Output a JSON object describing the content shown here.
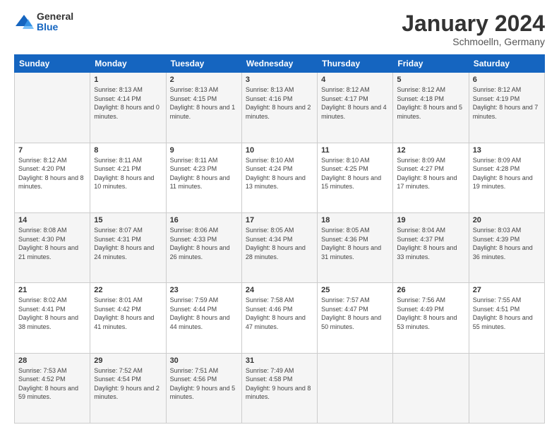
{
  "logo": {
    "general": "General",
    "blue": "Blue"
  },
  "header": {
    "month": "January 2024",
    "location": "Schmoelln, Germany"
  },
  "days_of_week": [
    "Sunday",
    "Monday",
    "Tuesday",
    "Wednesday",
    "Thursday",
    "Friday",
    "Saturday"
  ],
  "weeks": [
    [
      {
        "day": "",
        "sunrise": "",
        "sunset": "",
        "daylight": ""
      },
      {
        "day": "1",
        "sunrise": "Sunrise: 8:13 AM",
        "sunset": "Sunset: 4:14 PM",
        "daylight": "Daylight: 8 hours and 0 minutes."
      },
      {
        "day": "2",
        "sunrise": "Sunrise: 8:13 AM",
        "sunset": "Sunset: 4:15 PM",
        "daylight": "Daylight: 8 hours and 1 minute."
      },
      {
        "day": "3",
        "sunrise": "Sunrise: 8:13 AM",
        "sunset": "Sunset: 4:16 PM",
        "daylight": "Daylight: 8 hours and 2 minutes."
      },
      {
        "day": "4",
        "sunrise": "Sunrise: 8:12 AM",
        "sunset": "Sunset: 4:17 PM",
        "daylight": "Daylight: 8 hours and 4 minutes."
      },
      {
        "day": "5",
        "sunrise": "Sunrise: 8:12 AM",
        "sunset": "Sunset: 4:18 PM",
        "daylight": "Daylight: 8 hours and 5 minutes."
      },
      {
        "day": "6",
        "sunrise": "Sunrise: 8:12 AM",
        "sunset": "Sunset: 4:19 PM",
        "daylight": "Daylight: 8 hours and 7 minutes."
      }
    ],
    [
      {
        "day": "7",
        "sunrise": "Sunrise: 8:12 AM",
        "sunset": "Sunset: 4:20 PM",
        "daylight": "Daylight: 8 hours and 8 minutes."
      },
      {
        "day": "8",
        "sunrise": "Sunrise: 8:11 AM",
        "sunset": "Sunset: 4:21 PM",
        "daylight": "Daylight: 8 hours and 10 minutes."
      },
      {
        "day": "9",
        "sunrise": "Sunrise: 8:11 AM",
        "sunset": "Sunset: 4:23 PM",
        "daylight": "Daylight: 8 hours and 11 minutes."
      },
      {
        "day": "10",
        "sunrise": "Sunrise: 8:10 AM",
        "sunset": "Sunset: 4:24 PM",
        "daylight": "Daylight: 8 hours and 13 minutes."
      },
      {
        "day": "11",
        "sunrise": "Sunrise: 8:10 AM",
        "sunset": "Sunset: 4:25 PM",
        "daylight": "Daylight: 8 hours and 15 minutes."
      },
      {
        "day": "12",
        "sunrise": "Sunrise: 8:09 AM",
        "sunset": "Sunset: 4:27 PM",
        "daylight": "Daylight: 8 hours and 17 minutes."
      },
      {
        "day": "13",
        "sunrise": "Sunrise: 8:09 AM",
        "sunset": "Sunset: 4:28 PM",
        "daylight": "Daylight: 8 hours and 19 minutes."
      }
    ],
    [
      {
        "day": "14",
        "sunrise": "Sunrise: 8:08 AM",
        "sunset": "Sunset: 4:30 PM",
        "daylight": "Daylight: 8 hours and 21 minutes."
      },
      {
        "day": "15",
        "sunrise": "Sunrise: 8:07 AM",
        "sunset": "Sunset: 4:31 PM",
        "daylight": "Daylight: 8 hours and 24 minutes."
      },
      {
        "day": "16",
        "sunrise": "Sunrise: 8:06 AM",
        "sunset": "Sunset: 4:33 PM",
        "daylight": "Daylight: 8 hours and 26 minutes."
      },
      {
        "day": "17",
        "sunrise": "Sunrise: 8:05 AM",
        "sunset": "Sunset: 4:34 PM",
        "daylight": "Daylight: 8 hours and 28 minutes."
      },
      {
        "day": "18",
        "sunrise": "Sunrise: 8:05 AM",
        "sunset": "Sunset: 4:36 PM",
        "daylight": "Daylight: 8 hours and 31 minutes."
      },
      {
        "day": "19",
        "sunrise": "Sunrise: 8:04 AM",
        "sunset": "Sunset: 4:37 PM",
        "daylight": "Daylight: 8 hours and 33 minutes."
      },
      {
        "day": "20",
        "sunrise": "Sunrise: 8:03 AM",
        "sunset": "Sunset: 4:39 PM",
        "daylight": "Daylight: 8 hours and 36 minutes."
      }
    ],
    [
      {
        "day": "21",
        "sunrise": "Sunrise: 8:02 AM",
        "sunset": "Sunset: 4:41 PM",
        "daylight": "Daylight: 8 hours and 38 minutes."
      },
      {
        "day": "22",
        "sunrise": "Sunrise: 8:01 AM",
        "sunset": "Sunset: 4:42 PM",
        "daylight": "Daylight: 8 hours and 41 minutes."
      },
      {
        "day": "23",
        "sunrise": "Sunrise: 7:59 AM",
        "sunset": "Sunset: 4:44 PM",
        "daylight": "Daylight: 8 hours and 44 minutes."
      },
      {
        "day": "24",
        "sunrise": "Sunrise: 7:58 AM",
        "sunset": "Sunset: 4:46 PM",
        "daylight": "Daylight: 8 hours and 47 minutes."
      },
      {
        "day": "25",
        "sunrise": "Sunrise: 7:57 AM",
        "sunset": "Sunset: 4:47 PM",
        "daylight": "Daylight: 8 hours and 50 minutes."
      },
      {
        "day": "26",
        "sunrise": "Sunrise: 7:56 AM",
        "sunset": "Sunset: 4:49 PM",
        "daylight": "Daylight: 8 hours and 53 minutes."
      },
      {
        "day": "27",
        "sunrise": "Sunrise: 7:55 AM",
        "sunset": "Sunset: 4:51 PM",
        "daylight": "Daylight: 8 hours and 55 minutes."
      }
    ],
    [
      {
        "day": "28",
        "sunrise": "Sunrise: 7:53 AM",
        "sunset": "Sunset: 4:52 PM",
        "daylight": "Daylight: 8 hours and 59 minutes."
      },
      {
        "day": "29",
        "sunrise": "Sunrise: 7:52 AM",
        "sunset": "Sunset: 4:54 PM",
        "daylight": "Daylight: 9 hours and 2 minutes."
      },
      {
        "day": "30",
        "sunrise": "Sunrise: 7:51 AM",
        "sunset": "Sunset: 4:56 PM",
        "daylight": "Daylight: 9 hours and 5 minutes."
      },
      {
        "day": "31",
        "sunrise": "Sunrise: 7:49 AM",
        "sunset": "Sunset: 4:58 PM",
        "daylight": "Daylight: 9 hours and 8 minutes."
      },
      {
        "day": "",
        "sunrise": "",
        "sunset": "",
        "daylight": ""
      },
      {
        "day": "",
        "sunrise": "",
        "sunset": "",
        "daylight": ""
      },
      {
        "day": "",
        "sunrise": "",
        "sunset": "",
        "daylight": ""
      }
    ]
  ]
}
